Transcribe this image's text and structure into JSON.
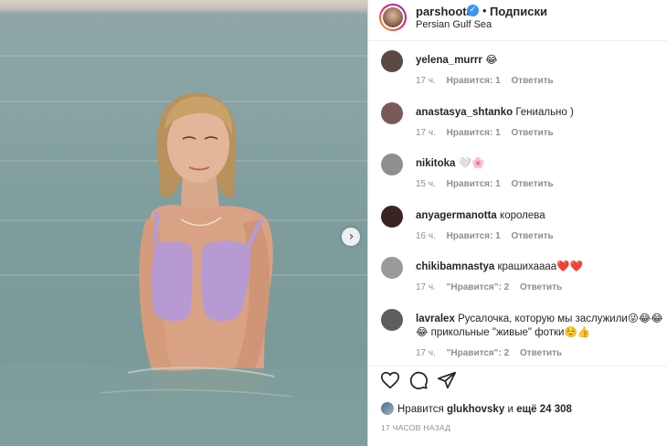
{
  "post": {
    "author": "parshoota",
    "follow_label": "Подписки",
    "location": "Persian Gulf Sea",
    "verified_mark": "✓",
    "separator": "•",
    "next_arrow": "›"
  },
  "comments": [
    {
      "user": "yelena_murrr",
      "text": "😂",
      "time": "17 ч.",
      "likes": "Нравится: 1",
      "reply": "Ответить",
      "avatar_color": "#5a4a42"
    },
    {
      "user": "anastasya_shtanko",
      "text": "Гениально )",
      "time": "17 ч.",
      "likes": "Нравится: 1",
      "reply": "Ответить",
      "avatar_color": "#7a5a58"
    },
    {
      "user": "nikitoka",
      "text": "🤍🌸",
      "time": "15 ч.",
      "likes": "Нравится: 1",
      "reply": "Ответить",
      "avatar_color": "#8f8f8f"
    },
    {
      "user": "anyagermanotta",
      "text": "королева",
      "time": "16 ч.",
      "likes": "Нравится: 1",
      "reply": "Ответить",
      "avatar_color": "#3a2320"
    },
    {
      "user": "chikibamnastya",
      "text": "крашихаааа❤️❤️",
      "time": "17 ч.",
      "likes": "\"Нравится\": 2",
      "reply": "Ответить",
      "avatar_color": "#9a9a9a"
    },
    {
      "user": "lavralex",
      "text": "Русалочка, которую мы заслужили😜😂😂",
      "text2": "😂 прикольные \"живые\" фотки☺️👍",
      "time": "17 ч.",
      "likes": "\"Нравится\": 2",
      "reply": "Ответить",
      "avatar_color": "#5e5e5e"
    }
  ],
  "actions": {
    "like_icon": "heart-icon",
    "comment_icon": "comment-icon",
    "share_icon": "share-icon"
  },
  "likes": {
    "prefix": "Нравится",
    "user": "glukhovsky",
    "middle": "и",
    "count": "ещё 24 308"
  },
  "time_ago": "17 ЧАСОВ НАЗАД",
  "colors": {
    "ring_gradient": [
      "#f9a825",
      "#e91e63",
      "#9c27b0"
    ],
    "verified": "#3897f0",
    "meta_text": "#8e8e8e",
    "text": "#262626"
  }
}
